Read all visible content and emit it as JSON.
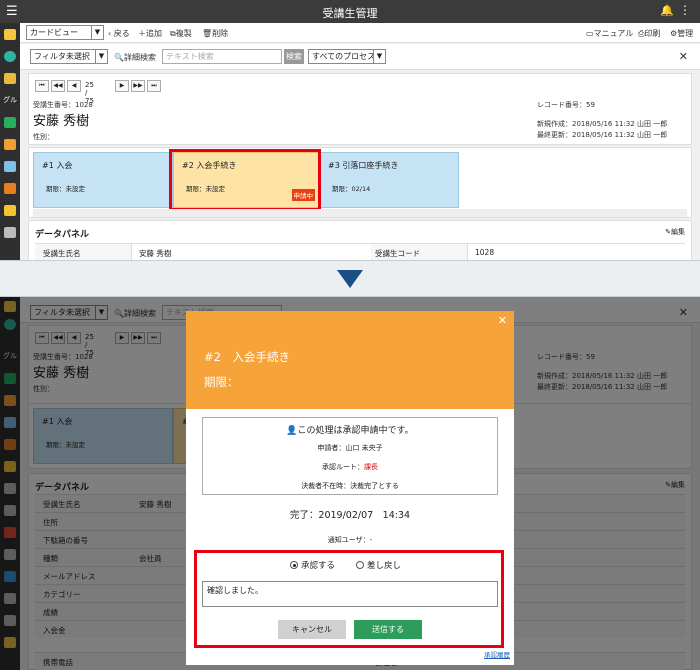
{
  "app_title": "受講生管理",
  "view_select": "カードビュー",
  "toolbar": {
    "back": "戻る",
    "add": "追加",
    "copy": "複製",
    "delete": "削除",
    "manual": "マニュアル",
    "print": "印刷",
    "admin": "管理"
  },
  "filter": {
    "select": "フィルタ未選択",
    "detail_search": "詳細検索",
    "search_placeholder": "テキスト検索",
    "search_button": "検索",
    "process_select": "すべてのプロセス"
  },
  "pager": {
    "position": "25 / 75"
  },
  "record": {
    "student_no": "受講生番号：1028",
    "name": "安藤 秀樹",
    "gender": "性別：",
    "record_no": "レコード番号：59",
    "created": "新規作成：2018/05/16 11:32 山田 一郎",
    "updated": "最終更新：2018/05/16 11:32 山田 一郎"
  },
  "steps": [
    {
      "title": "#1 入会",
      "due": "期限：未設定",
      "badge": ""
    },
    {
      "title": "#2 入会手続き",
      "due": "期限：未設定",
      "badge": "申請中"
    },
    {
      "title": "#3 引落口座手続き",
      "due": "期限：02/14",
      "badge": ""
    }
  ],
  "data_panel": {
    "title": "データパネル",
    "edit": "編集",
    "rows": [
      {
        "label": "受講生氏名",
        "value": "安藤 秀樹",
        "label2": "受講生コード",
        "value2": "1028"
      },
      {
        "label": "住所",
        "value": "",
        "label2": "",
        "value2": ""
      },
      {
        "label": "下駄箱の番号",
        "value": "",
        "label2": "",
        "value2": ""
      },
      {
        "label": "種類",
        "value": "会社員",
        "label2": "",
        "value2": ""
      },
      {
        "label": "メールアドレス",
        "value": "",
        "label2": "",
        "value2": ""
      },
      {
        "label": "カテゴリー",
        "value": "",
        "label2": "",
        "value2": ""
      },
      {
        "label": "成績",
        "value": "",
        "label2": "",
        "value2": ""
      },
      {
        "label": "入会金",
        "value": "",
        "label2": "",
        "value2": ""
      },
      {
        "label": "携帯電話",
        "value": "",
        "label2": "会社名",
        "value2": ""
      }
    ]
  },
  "modal": {
    "title": "#2　入会手続き",
    "due": "期限：",
    "approval_msg": "この処理は承認申請中です。",
    "applicant": "申請者：山口 未央子",
    "route_label": "承認ルート：",
    "route_value": "課長",
    "absence": "決裁者不在時：決裁完了とする",
    "done": "完了：2019/02/07　14:34",
    "notify": "通知ユーザ：-",
    "approve": "承認する",
    "reject": "差し戻し",
    "comment": "確認しました。",
    "cancel": "キャンセル",
    "send": "送信する",
    "link": "承認履歴"
  }
}
